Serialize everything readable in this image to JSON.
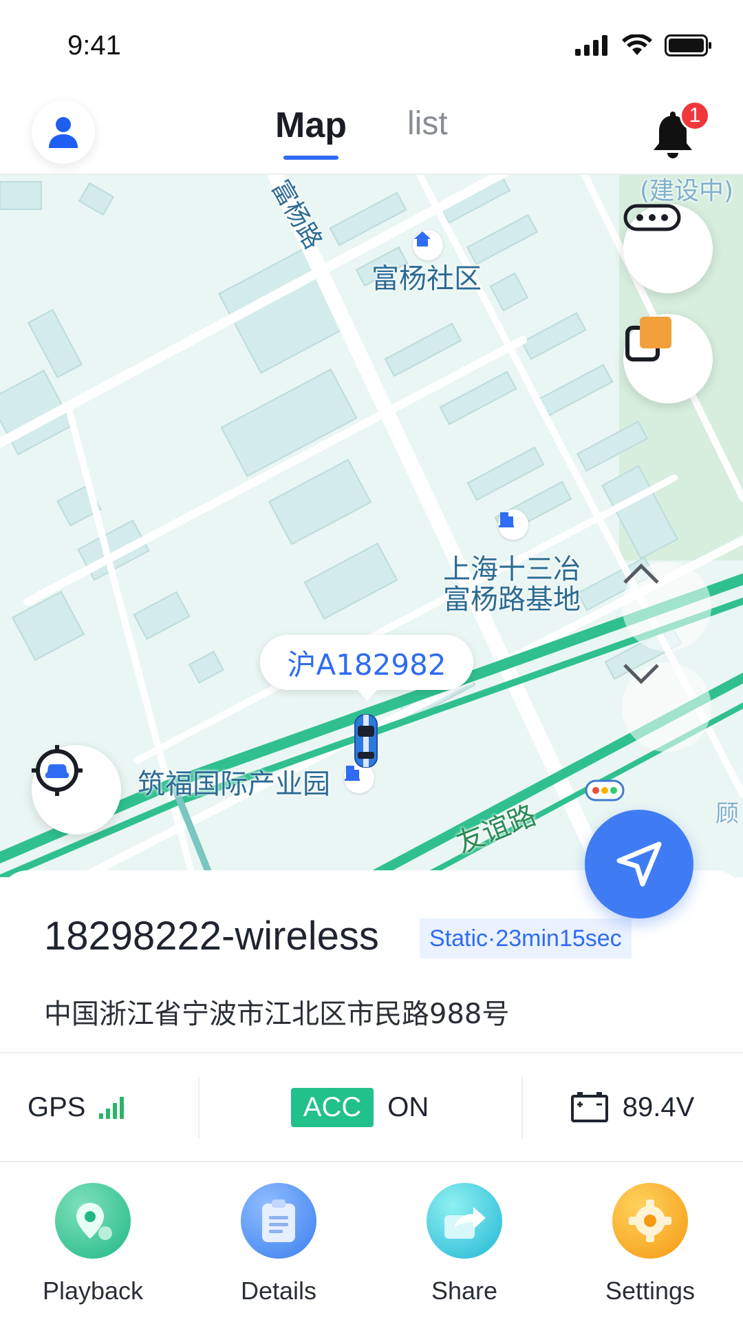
{
  "status_bar": {
    "time": "9:41"
  },
  "header": {
    "tabs": [
      {
        "label": "Map",
        "active": true
      },
      {
        "label": "list",
        "active": false
      }
    ],
    "notification_count": "1"
  },
  "map": {
    "labels": {
      "road_fuyang": "富杨路",
      "community": "富杨社区",
      "site_line1": "上海十三冶",
      "site_line2": "富杨路基地",
      "industrial_park": "筑福国际产业园",
      "road_youyi": "友谊路",
      "construction": "(建设中)",
      "edge_label": "顾"
    },
    "vehicle_plate": "沪A182982"
  },
  "device": {
    "name": "18298222-wireless",
    "status": "Static·23min15sec",
    "address": "中国浙江省宁波市江北区市民路988号"
  },
  "metrics": {
    "gps_label": "GPS",
    "acc_label": "ACC",
    "acc_state": "ON",
    "voltage": "89.4V"
  },
  "actions": [
    {
      "label": "Playback",
      "icon": "playback-icon",
      "color": "#2ec79a"
    },
    {
      "label": "Details",
      "icon": "details-icon",
      "color": "#4b8ff0"
    },
    {
      "label": "Share",
      "icon": "share-icon",
      "color": "#2cc6d8"
    },
    {
      "label": "Settings",
      "icon": "settings-icon",
      "color": "#f7a21b"
    }
  ],
  "colors": {
    "accent": "#2f6cf3",
    "acc_green": "#22c08a",
    "badge_red": "#f0383c"
  }
}
